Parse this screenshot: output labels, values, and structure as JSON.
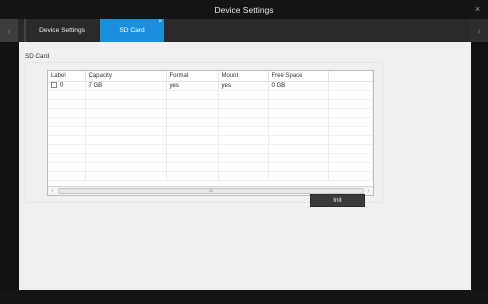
{
  "window": {
    "title": "Device Settings",
    "close_glyph": "×"
  },
  "tabs": [
    {
      "label": "Device Settings",
      "active": false
    },
    {
      "label": "SD Card",
      "active": true,
      "close_glyph": "×"
    }
  ],
  "tab_nav": {
    "left_glyph": "‹",
    "right_glyph": "›"
  },
  "sd_card": {
    "group_title": "SD Card",
    "columns": [
      "Label",
      "Capacity",
      "Format",
      "Mount",
      "Free Space"
    ],
    "rows": [
      {
        "label": "0",
        "capacity": "7 GB",
        "format": "yes",
        "mount": "yes",
        "free_space": "0 GB"
      }
    ],
    "scroll_left": "‹",
    "scroll_right": "›",
    "scroll_grip": "III",
    "init_button": "Init"
  },
  "colors": {
    "active_tab": "#1a8fde",
    "titlebar": "#141414",
    "content_bg": "#f0f0f0"
  }
}
